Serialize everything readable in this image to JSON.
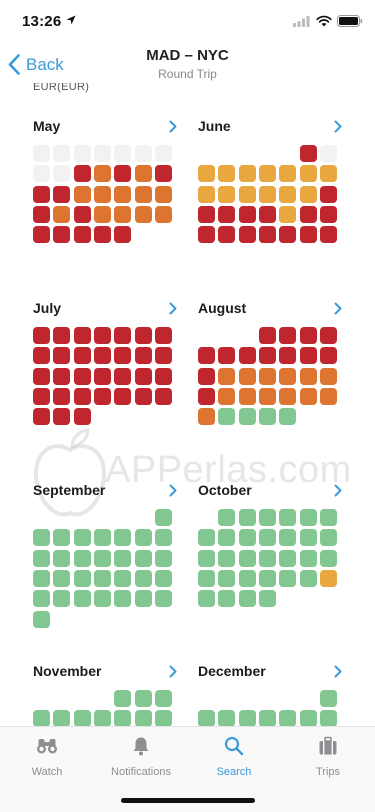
{
  "status_bar": {
    "time": "13:26",
    "icons": [
      "location-arrow-icon",
      "signal-icon",
      "wifi-icon",
      "battery-icon"
    ]
  },
  "nav": {
    "back_label": "Back",
    "title": "MAD – NYC",
    "subtitle": "Round Trip"
  },
  "currency_label": "EUR(EUR)",
  "colors": {
    "empty": "#f2f2f2",
    "high": "#c0262d",
    "mid": "#dd7531",
    "low": "#e8a73f",
    "best": "#82c792",
    "accent": "#3a9bd9",
    "tab_inactive": "#8e8e93"
  },
  "legend_codes": {
    "0": "empty",
    "1": "high",
    "2": "mid",
    "3": "low",
    "4": "best"
  },
  "months": [
    {
      "name": "May",
      "rows": [
        "0000000",
        "0012121",
        "1122222",
        "1212222",
        "11111"
      ]
    },
    {
      "name": "June",
      "rows": [
        "_____10",
        "3333333",
        "3333331",
        "1111311",
        "1111111"
      ]
    },
    {
      "name": "July",
      "rows": [
        "1111111",
        "1111111",
        "1111111",
        "1111111",
        "111"
      ]
    },
    {
      "name": "August",
      "rows": [
        "___1111",
        "1111111",
        "1222222",
        "1222222",
        "24444"
      ]
    },
    {
      "name": "September",
      "rows": [
        "______4",
        "4444444",
        "4444444",
        "4444444",
        "4444444",
        "4"
      ]
    },
    {
      "name": "October",
      "rows": [
        "_444444",
        "4444444",
        "4444444",
        "4444443",
        "4444"
      ]
    },
    {
      "name": "November",
      "rows": [
        "____444",
        "4444444"
      ]
    },
    {
      "name": "December",
      "rows": [
        "______4",
        "4444444"
      ]
    }
  ],
  "watermark": "APPerlas.com",
  "tabs": [
    {
      "label": "Watch",
      "icon": "binoculars-icon",
      "active": false
    },
    {
      "label": "Notifications",
      "icon": "bell-icon",
      "active": false
    },
    {
      "label": "Search",
      "icon": "search-icon",
      "active": true
    },
    {
      "label": "Trips",
      "icon": "suitcase-icon",
      "active": false
    }
  ]
}
